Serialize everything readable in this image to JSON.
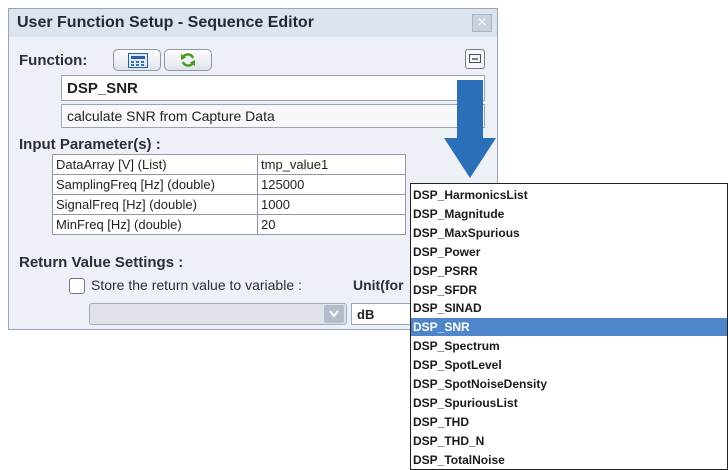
{
  "dialog": {
    "title": "User Function Setup - Sequence Editor",
    "close_glyph": "×",
    "function_label": "Function:",
    "function_name": "DSP_SNR",
    "description": "calculate SNR from Capture Data",
    "input_params_label": "Input Parameter(s) :",
    "params": [
      {
        "name": "DataArray [V] (List)",
        "value": "tmp_value1"
      },
      {
        "name": "SamplingFreq [Hz] (double)",
        "value": "125000"
      },
      {
        "name": "SignalFreq [Hz] (double)",
        "value": "1000"
      },
      {
        "name": "MinFreq [Hz] (double)",
        "value": "20"
      }
    ],
    "return_label": "Return Value Settings :",
    "store_label": "Store the return value to variable :",
    "unit_label": "Unit(for",
    "unit_value": "dB",
    "icons": [
      "calculator-icon",
      "refresh-icon",
      "collapse-icon",
      "chevron-down-icon",
      "down-arrow-indicator"
    ]
  },
  "dropdown": {
    "items": [
      "DSP_HarmonicsList",
      "DSP_Magnitude",
      "DSP_MaxSpurious",
      "DSP_Power",
      "DSP_PSRR",
      "DSP_SFDR",
      "DSP_SINAD",
      "DSP_SNR",
      "DSP_Spectrum",
      "DSP_SpotLevel",
      "DSP_SpotNoiseDensity",
      "DSP_SpuriousList",
      "DSP_THD",
      "DSP_THD_N",
      "DSP_TotalNoise"
    ],
    "selected": "DSP_SNR"
  },
  "colors": {
    "selection": "#4f86c9",
    "arrow": "#2a6fb8",
    "refresh": "#3f9a1d"
  }
}
